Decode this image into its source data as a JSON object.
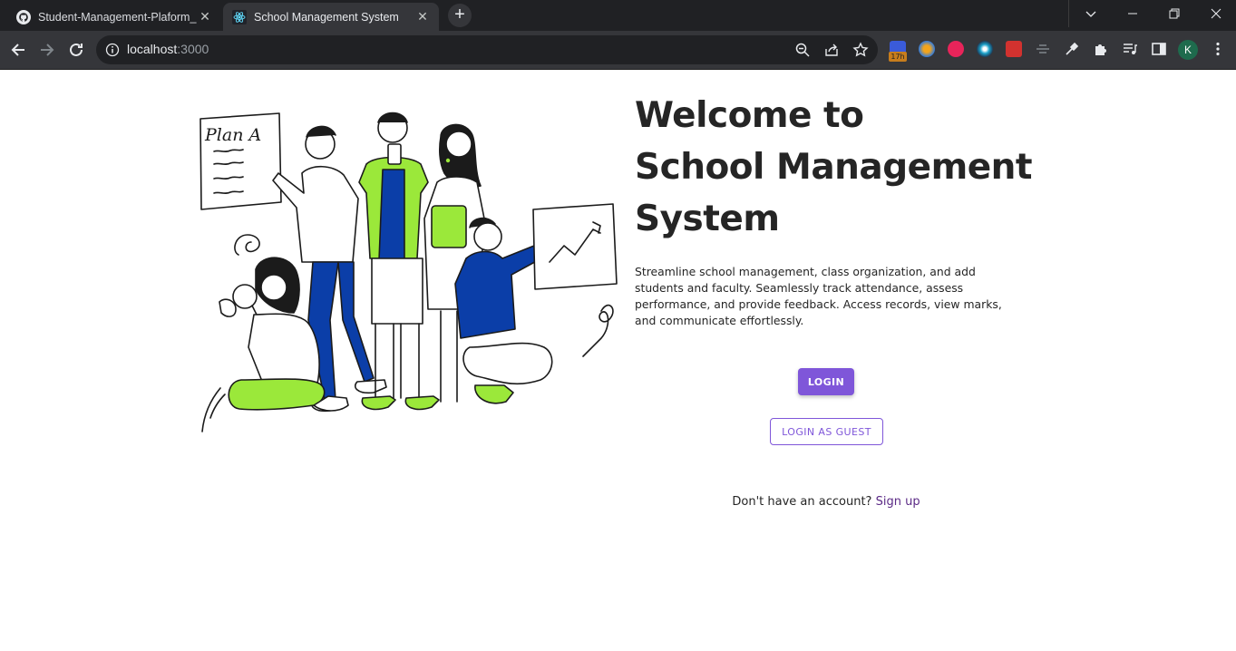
{
  "browser": {
    "tabs": [
      {
        "title": "Student-Management-Plaform_",
        "favicon": "github-icon"
      },
      {
        "title": "School Management System",
        "favicon": "react-icon"
      }
    ],
    "new_tab": "+",
    "address": {
      "host": "localhost",
      "port": ":3000"
    },
    "extensions": [
      "calendar-extension-icon",
      "colorful-extension-icon",
      "red-play-extension-icon",
      "teal-flower-extension-icon",
      "red-grid-extension-icon",
      "strikethrough-extension-icon",
      "eyedropper-extension-icon",
      "puzzle-extensions-icon",
      "media-list-icon",
      "side-panel-icon"
    ],
    "extension_badge": "17h",
    "profile_initial": "K"
  },
  "page": {
    "headline": [
      "Welcome to",
      "School Management",
      "System"
    ],
    "description": "Streamline school management, class organization, and add students and faculty. Seamlessly track attendance, assess performance, and provide feedback. Access records, view marks, and communicate effortlessly.",
    "login_label": "LOGIN",
    "guest_label": "LOGIN AS GUEST",
    "signup_prompt": "Don't have an account?",
    "signup_link": "Sign up",
    "illustration_text": "Plan A"
  },
  "colors": {
    "accent": "#7f56d9",
    "link": "#5b2a86",
    "illustration_blue": "#0b3ea8",
    "illustration_green": "#9be83a"
  }
}
